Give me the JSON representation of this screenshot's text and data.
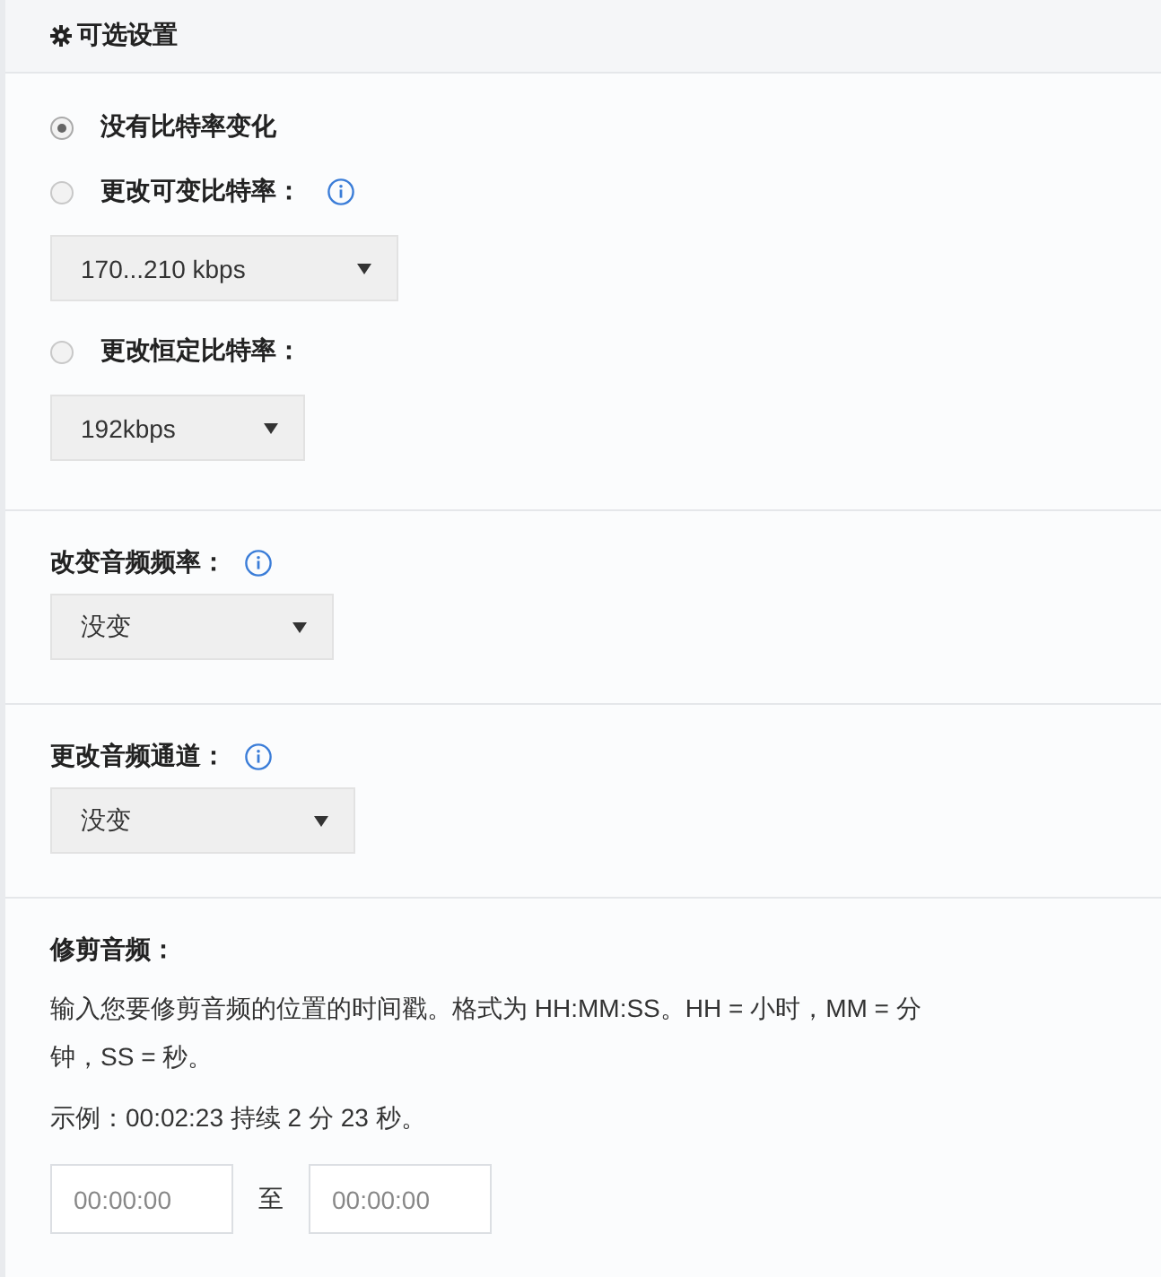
{
  "header": {
    "title": "可选设置"
  },
  "bitrate": {
    "options": [
      {
        "label": "没有比特率变化",
        "selected": true,
        "info": false
      },
      {
        "label": "更改可变比特率：",
        "selected": false,
        "info": true,
        "select": {
          "value": "170...210 kbps"
        }
      },
      {
        "label": "更改恒定比特率：",
        "selected": false,
        "info": false,
        "select": {
          "value": "192kbps"
        }
      }
    ]
  },
  "fields": [
    {
      "label": "改变音频频率：",
      "info": true,
      "select": {
        "value": "没变"
      }
    },
    {
      "label": "更改音频通道：",
      "info": true,
      "select": {
        "value": "没变"
      }
    }
  ],
  "trim": {
    "title": "修剪音频：",
    "description": "输入您要修剪音频的位置的时间戳。格式为 HH:MM:SS。HH = 小时，MM = 分钟，SS = 秒。",
    "example": "示例：00:02:23 持续 2 分 23 秒。",
    "start": {
      "placeholder": "00:00:00"
    },
    "separator": "至",
    "end": {
      "placeholder": "00:00:00"
    }
  }
}
